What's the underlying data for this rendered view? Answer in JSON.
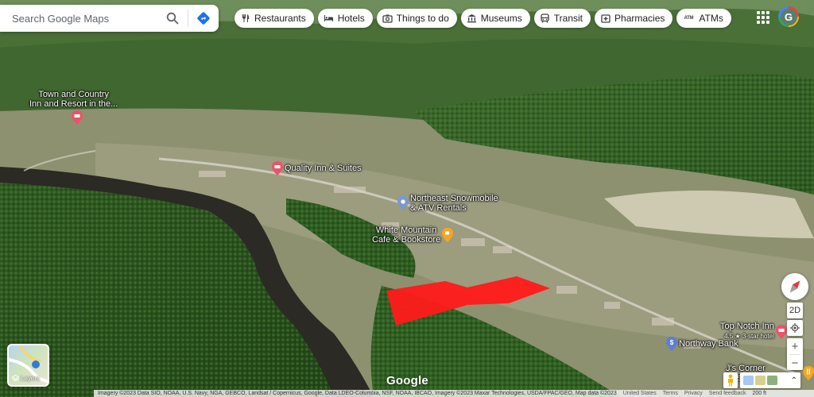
{
  "search": {
    "placeholder": "Search Google Maps"
  },
  "chips": [
    {
      "label": "Restaurants",
      "icon": "restaurant-icon"
    },
    {
      "label": "Hotels",
      "icon": "hotel-icon"
    },
    {
      "label": "Things to do",
      "icon": "camera-icon"
    },
    {
      "label": "Museums",
      "icon": "museum-icon"
    },
    {
      "label": "Transit",
      "icon": "transit-icon"
    },
    {
      "label": "Pharmacies",
      "icon": "pharmacy-icon"
    },
    {
      "label": "ATMs",
      "icon": "atm-icon"
    }
  ],
  "account": {
    "initial": "G"
  },
  "places": {
    "town_country": {
      "line1": "Town and Country",
      "line2": "Inn and Resort in the...",
      "color": "#e9546b"
    },
    "quality_inn": {
      "name": "Quality Inn & Suites",
      "color": "#e9546b"
    },
    "northeast": {
      "line1": "Northeast Snowmobile",
      "line2": "& ATV Rentals",
      "color": "#7b9acc"
    },
    "white_mountain": {
      "line1": "White Mountain",
      "line2": "Cafe & Bookstore",
      "color": "#f5a623"
    },
    "top_notch": {
      "name": "Top Notch Inn",
      "rating": "4.5",
      "type": "3-star hotel",
      "color": "#e9546b"
    },
    "northway": {
      "name": "Northway Bank",
      "color": "#5c7fd1"
    },
    "js_corner": {
      "name": "J's Corner Restaurant",
      "color": "#f5a623"
    }
  },
  "controls": {
    "view_mode": "2D",
    "zoom_in": "+",
    "zoom_out": "−"
  },
  "layers": {
    "label": "Layers"
  },
  "highlight": {
    "color": "#ff1a1a"
  },
  "logo": "Google",
  "footer": {
    "attribution": "Imagery ©2023 Data SIO, NOAA, U.S. Navy, NGA, GEBCO, Landsat / Copernicus, Google, Data LDEO-Columbia, NSF, NOAA, IBCAO, Imagery ©2023 Maxar Technologies, USDA/FPAC/GEO, Map data ©2023",
    "country": "United States",
    "terms": "Terms",
    "privacy": "Privacy",
    "feedback": "Send feedback",
    "scale": "200 ft"
  }
}
